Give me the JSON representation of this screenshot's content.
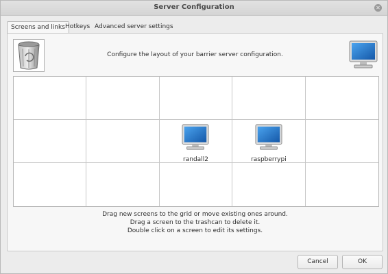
{
  "window": {
    "title": "Server Configuration"
  },
  "tabs": [
    {
      "label": "Screens and links",
      "active": true
    },
    {
      "label": "Hotkeys",
      "active": false
    },
    {
      "label": "Advanced server settings",
      "active": false
    }
  ],
  "main": {
    "heading": "Configure the layout of your barrier server configuration.",
    "grid": {
      "rows": 3,
      "cols": 5,
      "screens": [
        {
          "name": "randall2",
          "row": 2,
          "col": 3
        },
        {
          "name": "raspberrypi",
          "row": 2,
          "col": 4
        }
      ]
    },
    "hints": [
      "Drag new screens to the grid or move existing ones around.",
      "Drag a screen to the trashcan to delete it.",
      "Double click on a screen to edit its settings."
    ]
  },
  "buttons": {
    "cancel": "Cancel",
    "ok": "OK"
  },
  "colors": {
    "screen_blue": "#1e73c8",
    "window_bg": "#ececec"
  }
}
